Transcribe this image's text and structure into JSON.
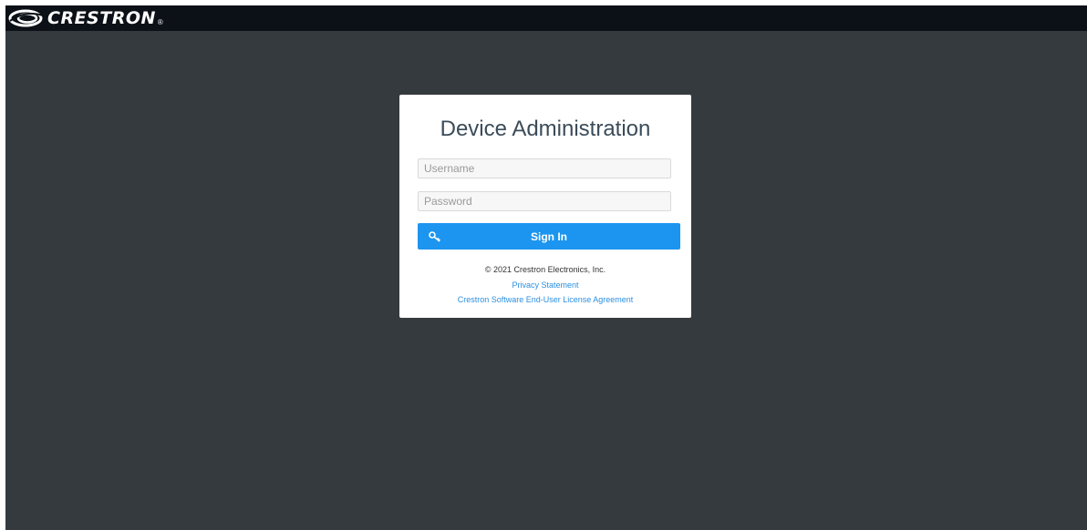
{
  "header": {
    "brand": "CRESTRON",
    "brand_mark": "®"
  },
  "login": {
    "title": "Device Administration",
    "username_placeholder": "Username",
    "password_placeholder": "Password",
    "signin_label": "Sign In",
    "signin_icon": "key-icon"
  },
  "footer": {
    "copyright": "© 2021 Crestron Electronics, Inc.",
    "privacy_link": "Privacy Statement",
    "eula_link": "Crestron Software End-User License Agreement"
  },
  "colors": {
    "page_background": "#353a3f",
    "topbar_background": "#0c1117",
    "card_background": "#ffffff",
    "accent_button": "#1c95f0",
    "link": "#2c8fe0",
    "title_text": "#3b4c59"
  }
}
